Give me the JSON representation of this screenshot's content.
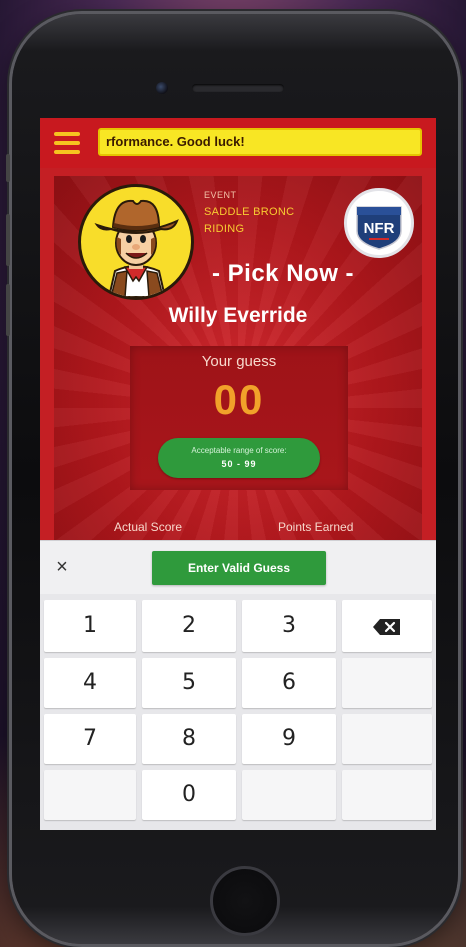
{
  "header": {
    "ticker_text": "rformance. Good luck!"
  },
  "event": {
    "label": "EVENT",
    "name": "SADDLE BRONC RIDING"
  },
  "logo": {
    "text": "NFR"
  },
  "pick": {
    "title": "- Pick Now -",
    "rider": "Willy Everride"
  },
  "guess": {
    "label": "Your guess",
    "value": "00",
    "range_label": "Acceptable range of score:",
    "range_value": "50 - 99"
  },
  "stats": {
    "actual_score_label": "Actual Score",
    "points_earned_label": "Points Earned"
  },
  "keyboard": {
    "close_label": "×",
    "enter_label": "Enter Valid Guess",
    "keys": [
      "1",
      "2",
      "3",
      "4",
      "5",
      "6",
      "7",
      "8",
      "9",
      "0"
    ]
  },
  "colors": {
    "brand_red": "#c41f24",
    "accent_yellow": "#f8e624",
    "guess_orange": "#f1a22a",
    "action_green": "#2f9a3c"
  }
}
